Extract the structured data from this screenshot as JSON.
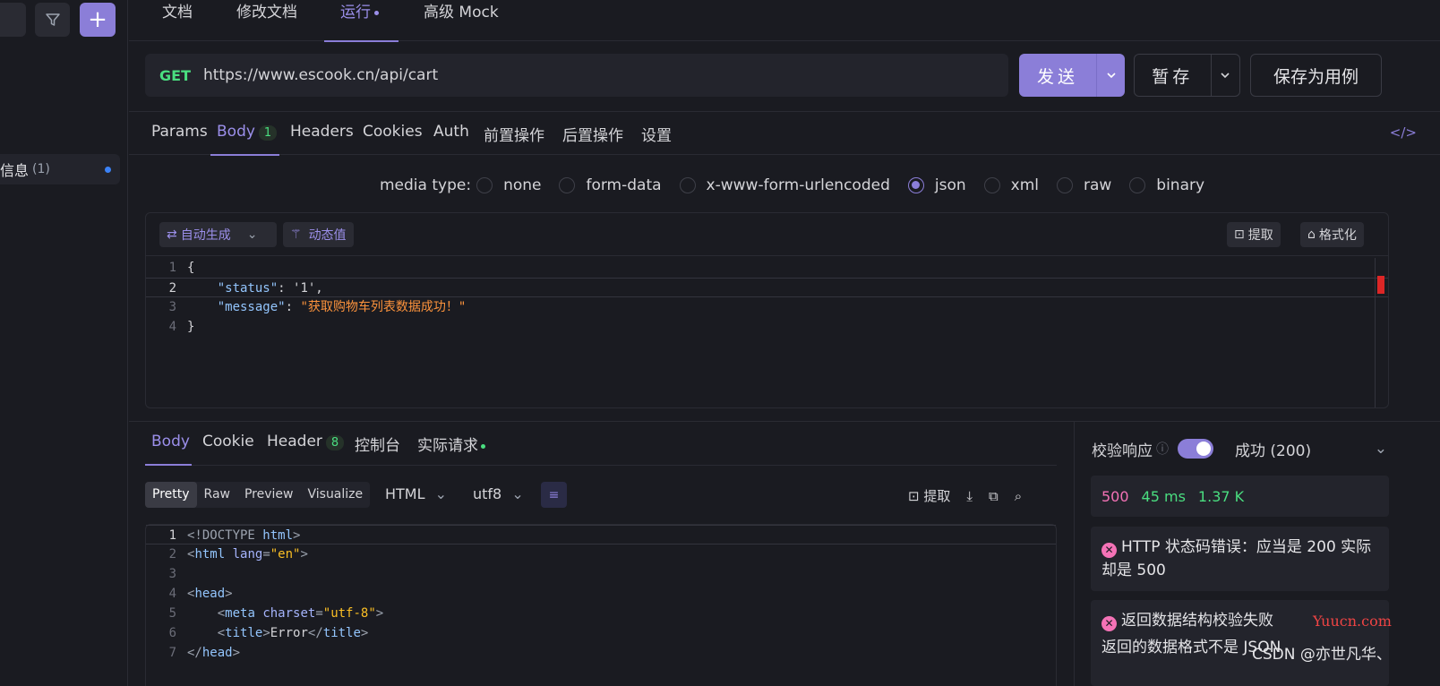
{
  "sidebar": {
    "item_label": "信息",
    "item_count": "(1)"
  },
  "top_tabs": {
    "docs": "文档",
    "edit_docs": "修改文档",
    "run": "运行",
    "mock": "高级 Mock"
  },
  "request": {
    "method": "GET",
    "url": "https://www.escook.cn/api/cart",
    "send": "发送",
    "save": "暂存",
    "save_case": "保存为用例"
  },
  "req_tabs": {
    "params": "Params",
    "body": "Body",
    "body_count": "1",
    "headers": "Headers",
    "cookies": "Cookies",
    "auth": "Auth",
    "pre": "前置操作",
    "post": "后置操作",
    "settings": "设置"
  },
  "media": {
    "label": "media type:",
    "options": [
      "none",
      "form-data",
      "x-www-form-urlencoded",
      "json",
      "xml",
      "raw",
      "binary"
    ],
    "selected": "json"
  },
  "editor": {
    "auto_gen": "自动生成",
    "dynamic": "动态值",
    "extract": "提取",
    "format": "格式化",
    "lines": [
      {
        "n": "1",
        "text": "{"
      },
      {
        "n": "2",
        "key": "\"status\"",
        "val": "'1',"
      },
      {
        "n": "3",
        "key": "\"message\"",
        "val": "\"获取购物车列表数据成功！\""
      },
      {
        "n": "4",
        "text": "}"
      }
    ]
  },
  "resp_tabs": {
    "body": "Body",
    "cookie": "Cookie",
    "header": "Header",
    "header_count": "8",
    "console": "控制台",
    "actual": "实际请求"
  },
  "resp_view": {
    "modes": [
      "Pretty",
      "Raw",
      "Preview",
      "Visualize"
    ],
    "format": "HTML",
    "encoding": "utf8",
    "extract": "提取"
  },
  "resp_code": {
    "lines": [
      "1",
      "2",
      "3",
      "4",
      "5",
      "6",
      "7"
    ]
  },
  "validation": {
    "label": "校验响应",
    "result": "成功 (200)",
    "status": "500",
    "time": "45 ms",
    "size": "1.37 K",
    "error1": "HTTP 状态码错误：应当是 200 实际却是 500",
    "error2_title": "返回数据结构校验失败",
    "error2_detail": "返回的数据格式不是 JSON"
  },
  "watermark": {
    "site": "Yuucn.com",
    "author": "CSDN @亦世凡华、"
  }
}
